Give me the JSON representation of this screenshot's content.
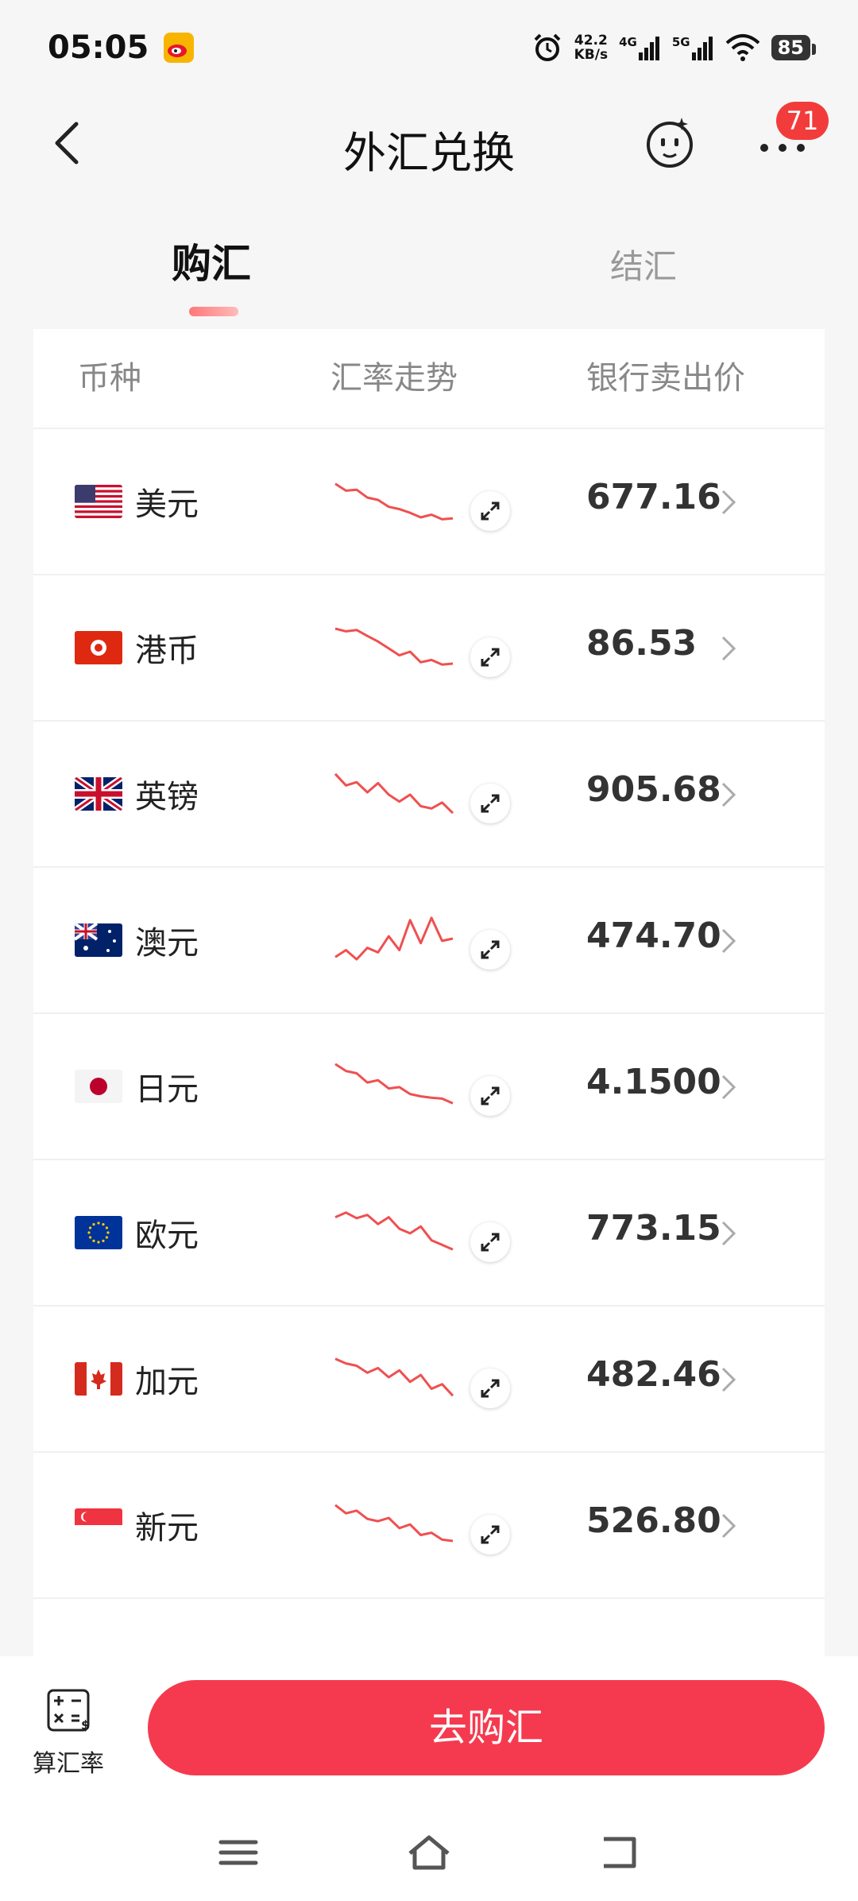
{
  "status_bar": {
    "time": "05:05",
    "speed_value": "42.2",
    "speed_unit": "KB/s",
    "net1": "4G",
    "net2": "5G",
    "battery": "85"
  },
  "header": {
    "title": "外汇兑换",
    "badge_count": "71"
  },
  "tabs": [
    {
      "label": "购汇",
      "active": true
    },
    {
      "label": "结汇",
      "active": false
    }
  ],
  "table": {
    "columns": [
      "币种",
      "汇率走势",
      "银行卖出价"
    ],
    "rows": [
      {
        "name": "美元",
        "price": "677.16",
        "flag": "us-flag",
        "trend": [
          0.85,
          0.7,
          0.72,
          0.55,
          0.5,
          0.35,
          0.3,
          0.22,
          0.12,
          0.18,
          0.08,
          0.1
        ]
      },
      {
        "name": "港币",
        "price": "86.53",
        "flag": "hk-flag",
        "trend": [
          0.88,
          0.82,
          0.85,
          0.72,
          0.6,
          0.45,
          0.3,
          0.38,
          0.15,
          0.2,
          0.1,
          0.12
        ]
      },
      {
        "name": "英镑",
        "price": "905.68",
        "flag": "gb-flag",
        "trend": [
          0.9,
          0.65,
          0.72,
          0.5,
          0.7,
          0.45,
          0.3,
          0.45,
          0.2,
          0.15,
          0.28,
          0.05
        ]
      },
      {
        "name": "澳元",
        "price": "474.70",
        "flag": "au-flag",
        "trend": [
          0.1,
          0.25,
          0.05,
          0.3,
          0.2,
          0.55,
          0.25,
          0.9,
          0.4,
          0.95,
          0.45,
          0.5
        ]
      },
      {
        "name": "日元",
        "price": "4.1500",
        "flag": "jp-flag",
        "trend": [
          0.95,
          0.8,
          0.75,
          0.55,
          0.6,
          0.42,
          0.45,
          0.3,
          0.25,
          0.22,
          0.2,
          0.1
        ]
      },
      {
        "name": "欧元",
        "price": "773.15",
        "flag": "eu-flag",
        "trend": [
          0.8,
          0.9,
          0.78,
          0.85,
          0.65,
          0.8,
          0.55,
          0.45,
          0.6,
          0.3,
          0.2,
          0.1
        ]
      },
      {
        "name": "加元",
        "price": "482.46",
        "flag": "ca-flag",
        "trend": [
          0.9,
          0.8,
          0.75,
          0.6,
          0.7,
          0.5,
          0.65,
          0.4,
          0.55,
          0.25,
          0.35,
          0.1
        ]
      },
      {
        "name": "新元",
        "price": "526.80",
        "flag": "sg-flag",
        "trend": [
          0.9,
          0.72,
          0.78,
          0.6,
          0.55,
          0.62,
          0.4,
          0.48,
          0.25,
          0.3,
          0.15,
          0.12
        ]
      }
    ]
  },
  "bottom": {
    "calc_label": "算汇率",
    "go_label": "去购汇"
  },
  "colors": {
    "accent": "#f53a4f",
    "trend_line": "#ef5050",
    "badge": "#f23c3c"
  }
}
